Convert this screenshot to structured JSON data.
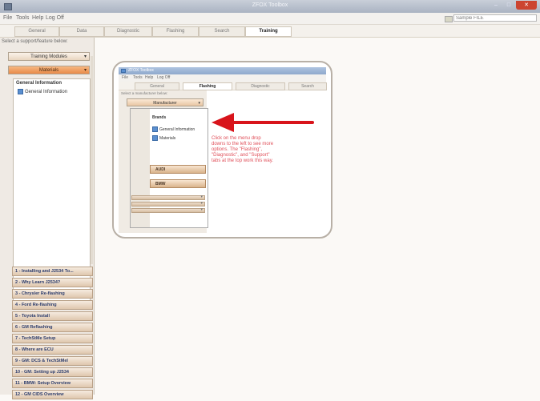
{
  "window": {
    "title": "ZFOX Toolbox",
    "min": "–",
    "max": "□",
    "close": "✕"
  },
  "menu": [
    "File",
    "Tools",
    "Help",
    "Log Off"
  ],
  "vin": {
    "value": "Sample FILE"
  },
  "tabs": [
    {
      "label": "General"
    },
    {
      "label": "Data"
    },
    {
      "label": "Diagnostic"
    },
    {
      "label": "Flashing"
    },
    {
      "label": "Search"
    },
    {
      "label": "Training"
    }
  ],
  "sidebar": {
    "select_label": "Select a support/feature below:",
    "feature_button": "Training Modules",
    "manufacturer_button": "Materials",
    "tree_heading": "General Information",
    "tree_item": "General Information"
  },
  "courses": [
    "1 - Installing and J2534 To...",
    "2 - Why Learn J2534?",
    "3 - Chrysler Re-flashing",
    "4 - Ford Re-flashing",
    "5 - Toyota Install",
    "6 - GM Reflashing",
    "7 - TechStMe Setup",
    "8 - Where are ECU",
    "9 - GM: DCS & TechStMel",
    "10 - GM: Setting up J2534",
    "11 - BMW: Setup Overview",
    "12 - GM CIDS Overview"
  ],
  "inset": {
    "title": "ZFOX Toolbox",
    "menu": [
      "File",
      "Tools",
      "Help",
      "Log Off"
    ],
    "tabs": [
      "General",
      "Flashing",
      "Diagnostic",
      "Search"
    ],
    "select_label": "Select a manufacturer below:",
    "manufacturer_button": "Manufacturer",
    "dropdown": {
      "option_header": "Brands",
      "options": [
        "General Information",
        "Materials"
      ],
      "brands": [
        "AUDI",
        "BMW"
      ]
    },
    "instruction": "Click on the menu drop downs to the left to see more options. The \"Flashing\", \"Diagnostic\", and \"Support\" tabs at the top work this way."
  },
  "icons": {
    "app": "app-icon",
    "tree": "document-icon",
    "chevron": "chevron-down-icon",
    "arrow": "red-arrow"
  },
  "colors": {
    "accent": "#e8602c",
    "arrow": "#d8141b",
    "instruction": "#e0505a",
    "course_text": "#2c3c6c"
  }
}
